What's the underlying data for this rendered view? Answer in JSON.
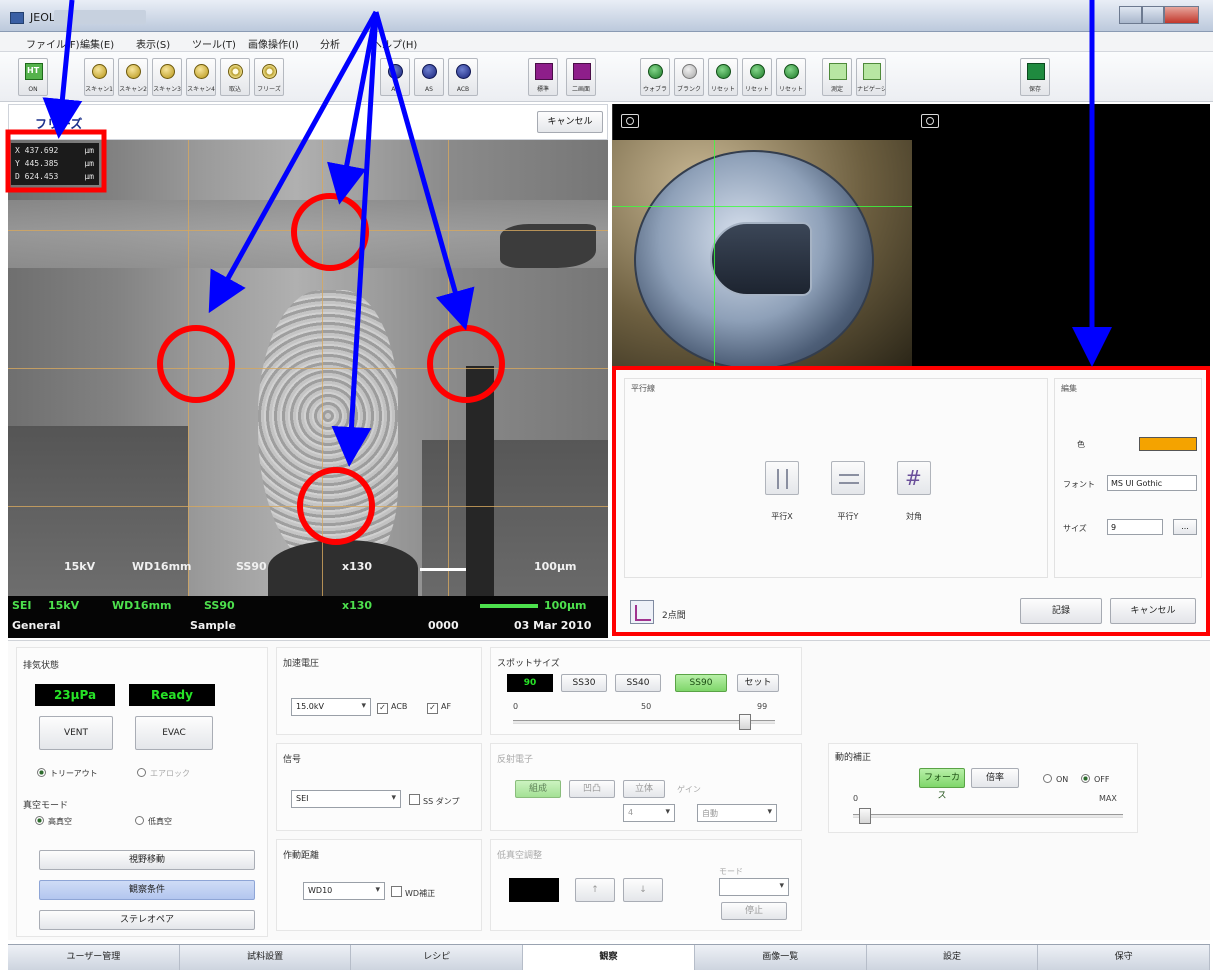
{
  "window": {
    "title": "JEOL"
  },
  "menu": [
    "ファイル(F)",
    "編集(E)",
    "表示(S)",
    "ツール(T)",
    "画像操作(I)",
    "分析",
    "ヘルプ(H)"
  ],
  "toolbar": {
    "ht": {
      "label": "HT",
      "sub": "ON"
    },
    "left_buttons": [
      "スキャン1",
      "スキャン2",
      "スキャン3",
      "スキャン4",
      "取込",
      "フリーズ"
    ],
    "navy_buttons": [
      "AF",
      "AS",
      "ACB"
    ],
    "view_buttons": [
      "標準",
      "二画面"
    ],
    "green_buttons": [
      "ウォブラ",
      "ブランク",
      "リセット",
      "リセット",
      "リセット",
      "測定",
      "ナビゲーション"
    ],
    "save_label": "保存"
  },
  "image_panel": {
    "mode_label": "フリーズ",
    "cancel_label": "キャンセル",
    "coords": [
      {
        "axis": "X",
        "value": "437.692",
        "unit": "μm"
      },
      {
        "axis": "Y",
        "value": "445.385",
        "unit": "μm"
      },
      {
        "axis": "D",
        "value": "624.453",
        "unit": "μm"
      }
    ],
    "overlay": {
      "kv": "15kV",
      "wd": "WD16mm",
      "ss": "SS90",
      "mag": "x130",
      "scale": "100μm"
    }
  },
  "status_strip": {
    "signal": "SEI",
    "kv": "15kV",
    "wd": "WD16mm",
    "ss": "SS90",
    "mag": "x130",
    "scale": "100μm",
    "mode": "General",
    "sample": "Sample",
    "number": "0000",
    "date": "03 Mar 2010"
  },
  "measure_panel": {
    "group_title": "平行線",
    "edit_title": "編集",
    "tools": [
      "平行X",
      "平行Y",
      "対角"
    ],
    "color_label": "色",
    "color_value": "#f4a300",
    "font_label": "フォント",
    "font_value": "MS UI Gothic",
    "size_label": "サイズ",
    "size_value": "9",
    "size_button": "...",
    "twopoint_label": "2点間",
    "record_label": "記録",
    "cancel_label": "キャンセル"
  },
  "lower": {
    "vacuum": {
      "title": "排気状態",
      "pressure": "23μPa",
      "status": "Ready",
      "vent": "VENT",
      "evac": "EVAC",
      "radio_a": "トリーアウト",
      "radio_b": "エアロック",
      "mode_title": "真空モード",
      "high": "高真空",
      "low": "低真空",
      "btn_move": "視野移動",
      "btn_cond": "観察条件",
      "btn_stereo": "ステレオペア"
    },
    "accel": {
      "title": "加速電圧",
      "value": "15.0kV",
      "acb": "ACB",
      "af": "AF"
    },
    "signal": {
      "title": "信号",
      "value": "SEI",
      "check": "SS ダンプ"
    },
    "wd": {
      "title": "作動距離",
      "value": "WD10",
      "check": "WD補正"
    },
    "spot": {
      "title": "スポットサイズ",
      "value": "90",
      "presets": [
        "SS30",
        "SS40",
        "SS90"
      ],
      "set": "セット",
      "ticks": [
        "0",
        "50",
        "99"
      ]
    },
    "backscatter": {
      "title": "反射電子",
      "modes": [
        "組成",
        "凹凸",
        "立体"
      ],
      "gain_label": "ゲイン",
      "select_a": "4",
      "select_b": "自動"
    },
    "lowvac": {
      "title": "低真空調整",
      "mode_label": "モード",
      "stop": "停止"
    },
    "dyn": {
      "title": "動的補正",
      "focus": "フォーカス",
      "ratio": "倍率",
      "on": "ON",
      "off": "OFF",
      "min": "0",
      "max": "MAX"
    }
  },
  "tabs": [
    "ユーザー管理",
    "試料設置",
    "レシピ",
    "観察",
    "画像一覧",
    "設定",
    "保守"
  ],
  "annotation_colors": {
    "arrow": "#0000ff",
    "highlight": "#ff0000"
  }
}
